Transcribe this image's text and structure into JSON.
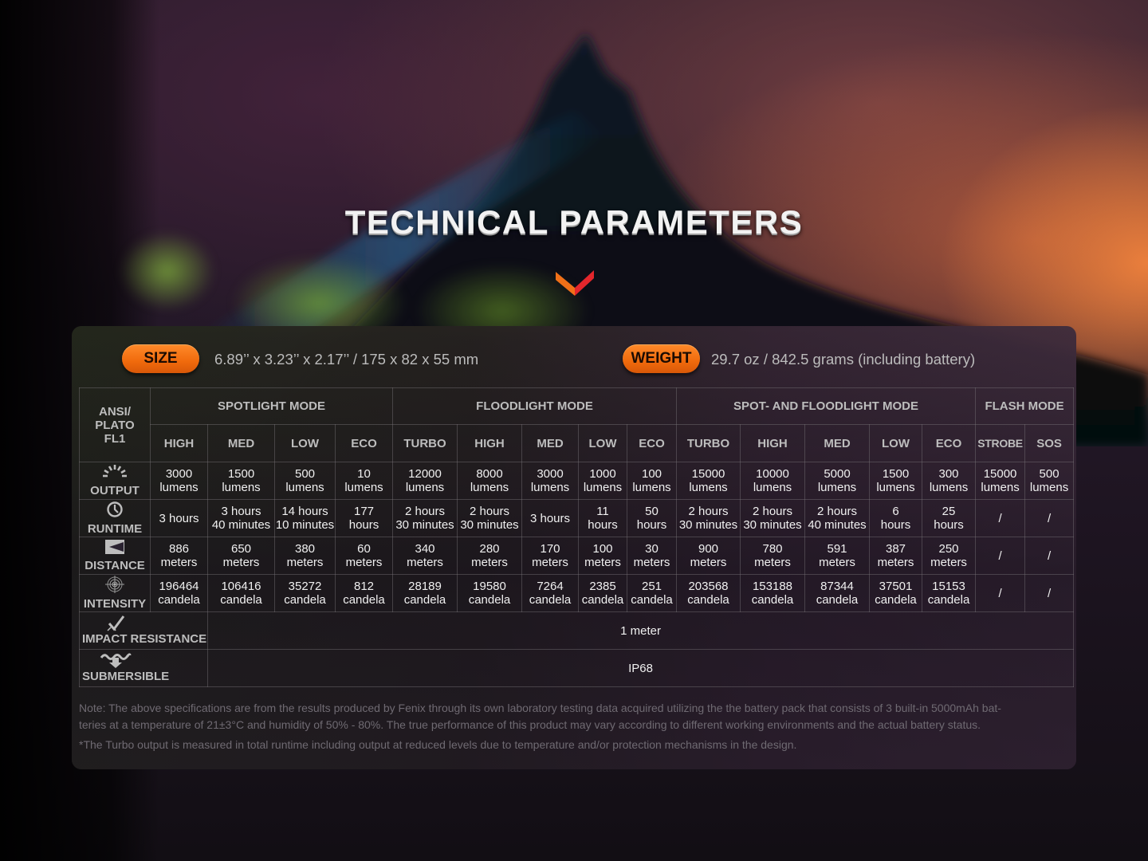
{
  "page": {
    "title": "TECHNICAL PARAMETERS",
    "accent_colors": {
      "orange": "#f06a0c",
      "red": "#e02a2a"
    }
  },
  "specs": {
    "size_label": "SIZE",
    "size_value": "6.89’’ x 3.23’’ x 2.17’’ / 175 x 82 x 55 mm",
    "weight_label": "WEIGHT",
    "weight_value": "29.7 oz / 842.5 grams (including battery)"
  },
  "table": {
    "corner_label": [
      "ANSI/",
      "PLATO",
      "FL1"
    ],
    "mode_groups": [
      {
        "label": "SPOTLIGHT MODE",
        "modes": [
          "HIGH",
          "MED",
          "LOW",
          "ECO"
        ]
      },
      {
        "label": "FLOODLIGHT MODE",
        "modes": [
          "TURBO",
          "HIGH",
          "MED",
          "LOW",
          "ECO"
        ]
      },
      {
        "label": "SPOT- AND FLOODLIGHT MODE",
        "modes": [
          "TURBO",
          "HIGH",
          "MED",
          "LOW",
          "ECO"
        ]
      },
      {
        "label": "FLASH MODE",
        "modes": [
          "STROBE",
          "SOS"
        ]
      }
    ],
    "rows": [
      {
        "label": "OUTPUT",
        "icon": "sunburst-icon",
        "cells": [
          [
            "3000",
            "lumens"
          ],
          [
            "1500",
            "lumens"
          ],
          [
            "500",
            "lumens"
          ],
          [
            "10",
            "lumens"
          ],
          [
            "12000",
            "lumens"
          ],
          [
            "8000",
            "lumens"
          ],
          [
            "3000",
            "lumens"
          ],
          [
            "1000",
            "lumens"
          ],
          [
            "100",
            "lumens"
          ],
          [
            "15000",
            "lumens"
          ],
          [
            "10000",
            "lumens"
          ],
          [
            "5000",
            "lumens"
          ],
          [
            "1500",
            "lumens"
          ],
          [
            "300",
            "lumens"
          ],
          [
            "15000",
            "lumens"
          ],
          [
            "500",
            "lumens"
          ]
        ]
      },
      {
        "label": "RUNTIME",
        "icon": "clock-icon",
        "cells": [
          [
            "3 hours"
          ],
          [
            "3 hours",
            "40 minutes"
          ],
          [
            "14 hours",
            "10 minutes"
          ],
          [
            "177",
            "hours"
          ],
          [
            "2 hours",
            "30 minutes"
          ],
          [
            "2 hours",
            "30 minutes"
          ],
          [
            "3 hours"
          ],
          [
            "11",
            "hours"
          ],
          [
            "50",
            "hours"
          ],
          [
            "2 hours",
            "30 minutes"
          ],
          [
            "2 hours",
            "30 minutes"
          ],
          [
            "2 hours",
            "40 minutes"
          ],
          [
            "6",
            "hours"
          ],
          [
            "25",
            "hours"
          ],
          [
            "/"
          ],
          [
            "/"
          ]
        ]
      },
      {
        "label": "DISTANCE",
        "icon": "beam-distance-icon",
        "cells": [
          [
            "886",
            "meters"
          ],
          [
            "650",
            "meters"
          ],
          [
            "380",
            "meters"
          ],
          [
            "60",
            "meters"
          ],
          [
            "340",
            "meters"
          ],
          [
            "280",
            "meters"
          ],
          [
            "170",
            "meters"
          ],
          [
            "100",
            "meters"
          ],
          [
            "30",
            "meters"
          ],
          [
            "900",
            "meters"
          ],
          [
            "780",
            "meters"
          ],
          [
            "591",
            "meters"
          ],
          [
            "387",
            "meters"
          ],
          [
            "250",
            "meters"
          ],
          [
            "/"
          ],
          [
            "/"
          ]
        ]
      },
      {
        "label": "INTENSITY",
        "icon": "target-icon",
        "cells": [
          [
            "196464",
            "candela"
          ],
          [
            "106416",
            "candela"
          ],
          [
            "35272",
            "candela"
          ],
          [
            "812",
            "candela"
          ],
          [
            "28189",
            "candela"
          ],
          [
            "19580",
            "candela"
          ],
          [
            "7264",
            "candela"
          ],
          [
            "2385",
            "candela"
          ],
          [
            "251",
            "candela"
          ],
          [
            "203568",
            "candela"
          ],
          [
            "153188",
            "candela"
          ],
          [
            "87344",
            "candela"
          ],
          [
            "37501",
            "candela"
          ],
          [
            "15153",
            "candela"
          ],
          [
            "/"
          ],
          [
            "/"
          ]
        ]
      }
    ],
    "impact_label": "IMPACT RESISTANCE",
    "impact_value": "1 meter",
    "submersible_label": "SUBMERSIBLE",
    "submersible_value": "IP68"
  },
  "notes": {
    "line1": "Note: The above specifications are from the results produced by Fenix through its own laboratory testing data acquired utilizing the the battery pack that consists of 3 built-in 5000mAh bat-",
    "line2": "teries at a temperature of 21±3°C and humidity of 50% - 80%. The true performance of this product may vary according to different working environments and the actual battery status.",
    "line3": "*The Turbo output is measured in total runtime including output at reduced levels due to temperature and/or protection mechanisms in the design."
  }
}
